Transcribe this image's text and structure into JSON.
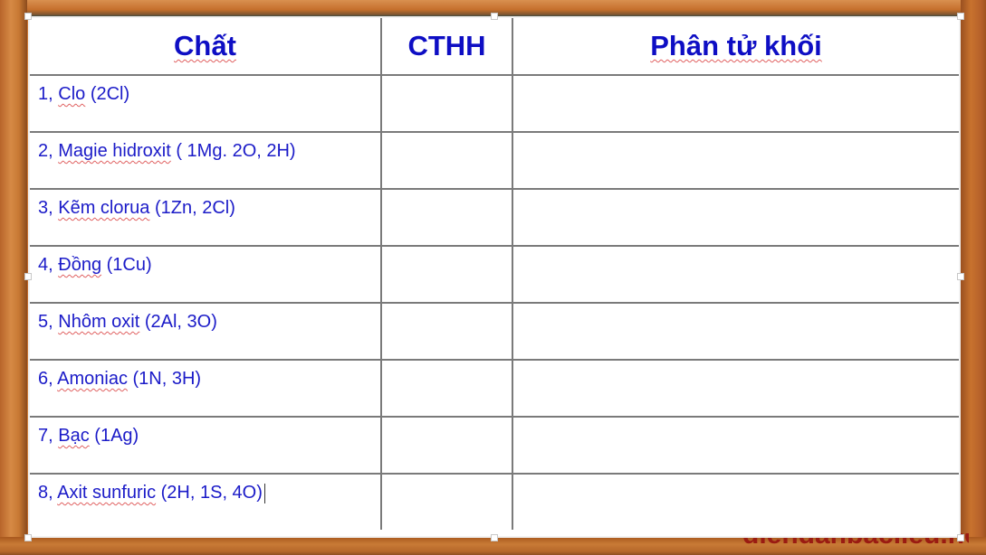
{
  "table": {
    "headers": [
      "Chất",
      "CTHH",
      "Phân tử khối"
    ],
    "rows": [
      {
        "num": "1,",
        "name": "Clo",
        "atoms": "(2Cl)",
        "formula": "",
        "molecular_mass": ""
      },
      {
        "num": "2,",
        "name": "Magie hidroxit",
        "atoms": "( 1Mg. 2O, 2H)",
        "formula": "",
        "molecular_mass": ""
      },
      {
        "num": "3,",
        "name": "Kẽm clorua",
        "atoms": "(1Zn, 2Cl)",
        "formula": "",
        "molecular_mass": ""
      },
      {
        "num": "4,",
        "name": "Đồng",
        "atoms": "(1Cu)",
        "formula": "",
        "molecular_mass": ""
      },
      {
        "num": "5,",
        "name": "Nhôm oxit",
        "atoms": "(2Al, 3O)",
        "formula": "",
        "molecular_mass": ""
      },
      {
        "num": "6,",
        "name": "Amoniac",
        "atoms": "(1N, 3H)",
        "formula": "",
        "molecular_mass": ""
      },
      {
        "num": "7,",
        "name": "Bạc",
        "atoms": "(1Ag)",
        "formula": "",
        "molecular_mass": ""
      },
      {
        "num": "8,",
        "name": "Axit sunfuric",
        "atoms": "(2H, 1S, 4O)",
        "formula": "",
        "molecular_mass": ""
      }
    ]
  },
  "watermark": "diendanbaclieu.net",
  "colors": {
    "text": "#1b1bc8",
    "header_text": "#0e0ec4",
    "frame": "#c8702c",
    "spellcheck": "#e06060"
  }
}
